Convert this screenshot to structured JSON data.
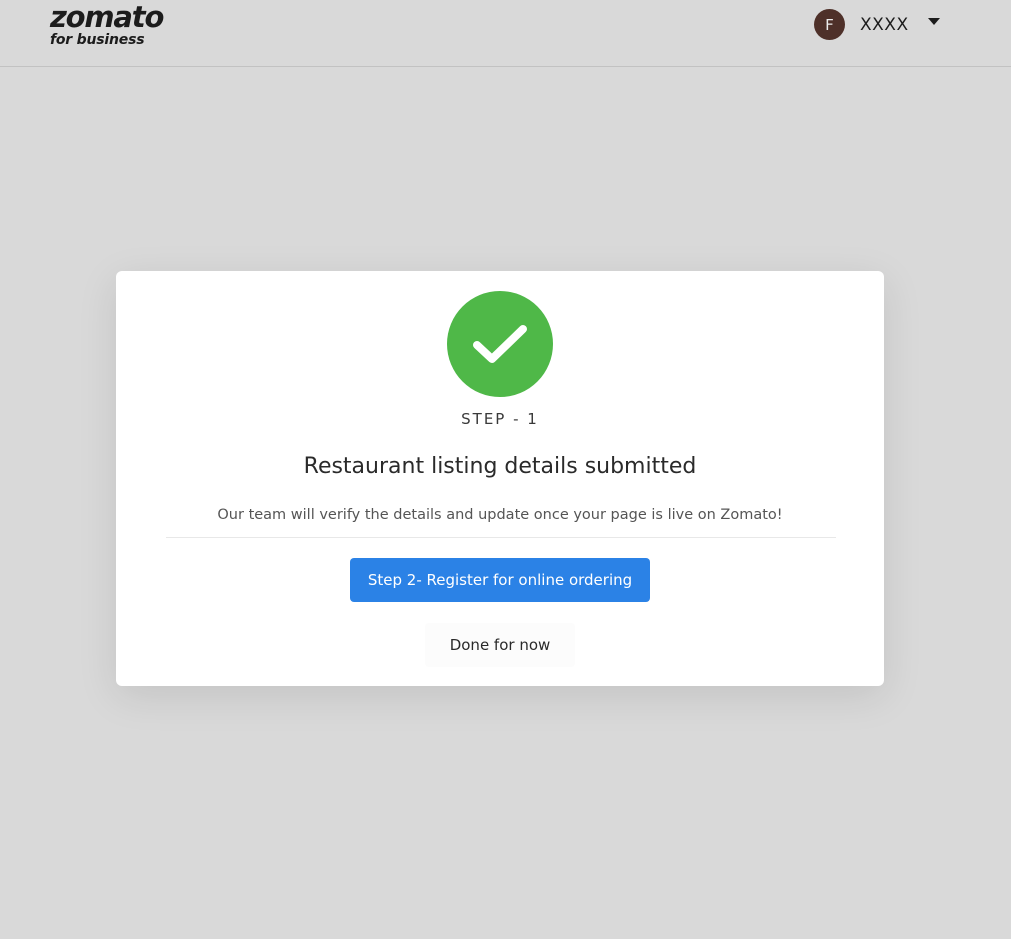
{
  "header": {
    "logo_main": "zomato",
    "logo_sub": "for business",
    "user": {
      "avatar_initial": "F",
      "name": "XXXX",
      "dropdown_icon": "caret-down-icon"
    }
  },
  "modal": {
    "icon": "check-circle-icon",
    "step_label": "STEP - 1",
    "title": "Restaurant listing details submitted",
    "description": "Our team will verify the details and update once your page is live on Zomato!",
    "primary_button": "Step 2- Register for online ordering",
    "secondary_button": "Done for now"
  },
  "colors": {
    "background": "#d9d9d9",
    "success_green": "#4fb848",
    "primary_blue": "#2b82e6",
    "avatar_brown": "#4e3029"
  }
}
